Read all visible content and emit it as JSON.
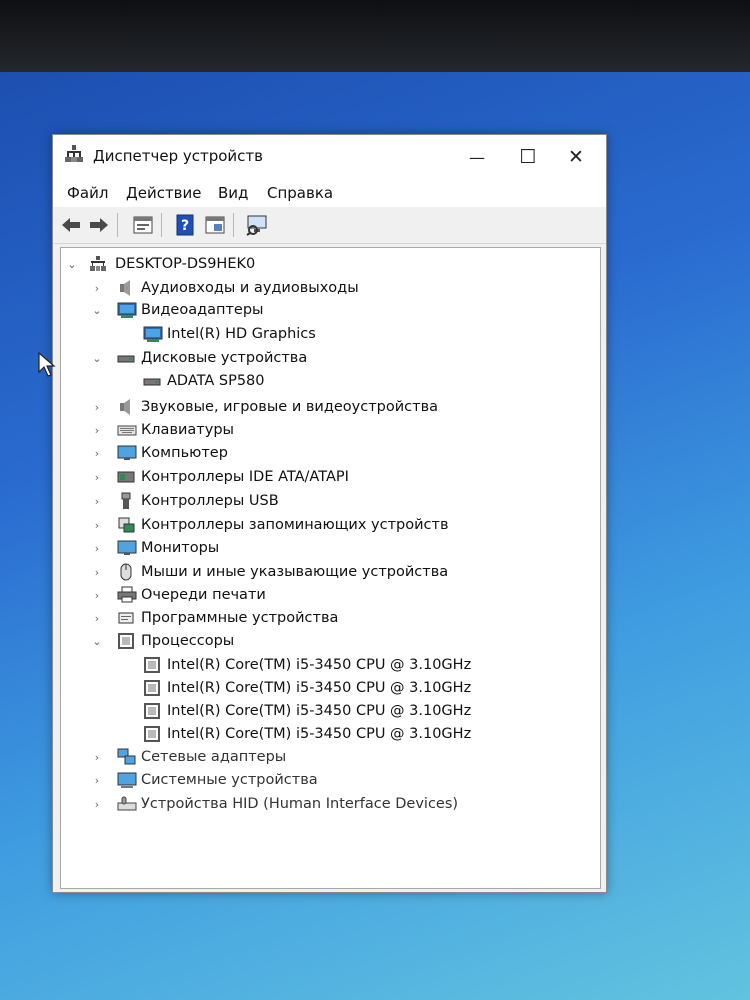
{
  "window": {
    "title": "Диспетчер устройств",
    "minimize_glyph": "—",
    "maximize_glyph": "☐",
    "close_glyph": "✕"
  },
  "menu": [
    "Файл",
    "Действие",
    "Вид",
    "Справка"
  ],
  "toolbar": {
    "buttons": [
      "back-icon",
      "forward-icon",
      "properties-icon",
      "help-icon",
      "update-driver-icon",
      "scan-hardware-icon"
    ]
  },
  "tree": {
    "root": "DESKTOP-DS9HEK0",
    "nodes": [
      {
        "label": "Аудиовходы и аудиовыходы",
        "expanded": false,
        "icon": "speaker-icon"
      },
      {
        "label": "Видеоадаптеры",
        "expanded": true,
        "icon": "display-adapter-icon",
        "children": [
          "Intel(R) HD Graphics"
        ]
      },
      {
        "label": "Дисковые устройства",
        "expanded": true,
        "icon": "disk-drive-icon",
        "children": [
          "ADATA SP580"
        ]
      },
      {
        "label": "Звуковые, игровые и видеоустройства",
        "expanded": false,
        "icon": "sound-icon"
      },
      {
        "label": "Клавиатуры",
        "expanded": false,
        "icon": "keyboard-icon"
      },
      {
        "label": "Компьютер",
        "expanded": false,
        "icon": "computer-icon"
      },
      {
        "label": "Контроллеры IDE ATA/ATAPI",
        "expanded": false,
        "icon": "ide-controller-icon"
      },
      {
        "label": "Контроллеры USB",
        "expanded": false,
        "icon": "usb-icon"
      },
      {
        "label": "Контроллеры запоминающих устройств",
        "expanded": false,
        "icon": "storage-controller-icon"
      },
      {
        "label": "Мониторы",
        "expanded": false,
        "icon": "monitor-icon"
      },
      {
        "label": "Мыши и иные указывающие устройства",
        "expanded": false,
        "icon": "mouse-icon"
      },
      {
        "label": "Очереди печати",
        "expanded": false,
        "icon": "printer-icon"
      },
      {
        "label": "Программные устройства",
        "expanded": false,
        "icon": "software-device-icon"
      },
      {
        "label": "Процессоры",
        "expanded": true,
        "icon": "processor-icon",
        "children": [
          "Intel(R) Core(TM) i5-3450 CPU @ 3.10GHz",
          "Intel(R) Core(TM) i5-3450 CPU @ 3.10GHz",
          "Intel(R) Core(TM) i5-3450 CPU @ 3.10GHz",
          "Intel(R) Core(TM) i5-3450 CPU @ 3.10GHz"
        ]
      },
      {
        "label": "Сетевые адаптеры",
        "expanded": false,
        "icon": "network-adapter-icon"
      },
      {
        "label": "Системные устройства",
        "expanded": false,
        "icon": "system-device-icon"
      },
      {
        "label": "Устройства HID (Human Interface Devices)",
        "expanded": false,
        "icon": "hid-icon"
      }
    ]
  },
  "colors": {
    "desktop_top": "#1d4fb0",
    "desktop_bottom": "#62c3df",
    "window_bg": "#f0f0f0",
    "tree_bg": "#ffffff"
  }
}
